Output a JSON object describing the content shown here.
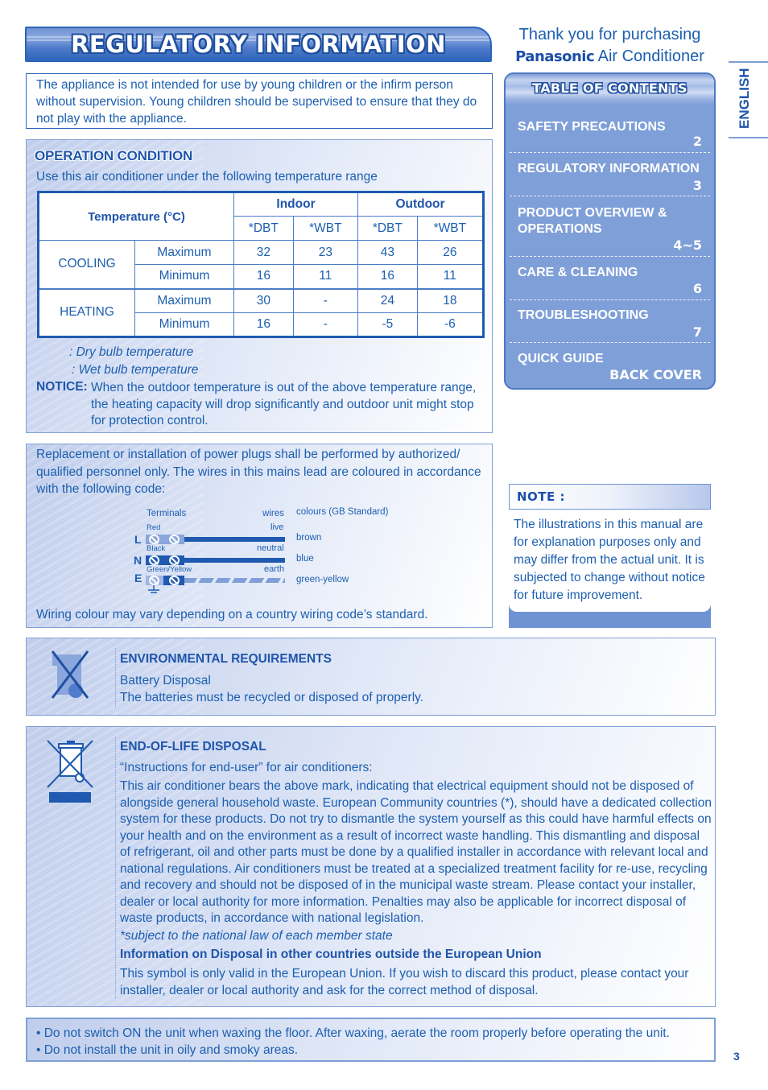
{
  "title": "REGULATORY INFORMATION",
  "warning": "The appliance is not intended for use by young children or the infirm person without supervision. Young children should be supervised to ensure that they do not play with the appliance.",
  "operation_condition": {
    "heading": "OPERATION CONDITION",
    "subtitle": "Use this air conditioner under the following temperature range",
    "table": {
      "corner_header": "Temperature (°C)",
      "group_headers": [
        "Indoor",
        "Outdoor"
      ],
      "sub_headers": [
        "*DBT",
        "*WBT",
        "*DBT",
        "*WBT"
      ],
      "rows": [
        {
          "mode": "COOLING",
          "level": "Maximum",
          "values": [
            "32",
            "23",
            "43",
            "26"
          ]
        },
        {
          "mode": "COOLING",
          "level": "Minimum",
          "values": [
            "16",
            "11",
            "16",
            "11"
          ]
        },
        {
          "mode": "HEATING",
          "level": "Maximum",
          "values": [
            "30",
            "-",
            "24",
            "18"
          ]
        },
        {
          "mode": "HEATING",
          "level": "Minimum",
          "values": [
            "16",
            "-",
            "-5",
            "-6"
          ]
        }
      ]
    },
    "legend": [
      ": Dry bulb temperature",
      ": Wet bulb temperature"
    ],
    "notice_label": "NOTICE:",
    "notice_text": "When the outdoor temperature is out of the above temperature range, the heating capacity will drop significantly and outdoor unit might stop for protection control."
  },
  "wiring": {
    "intro": "Replacement or installation of power plugs shall be performed by authorized/ qualified personnel only. The wires in this mains lead are coloured in accordance with the following code:",
    "terminals_label": "Terminals",
    "wires_label": "wires",
    "colours_label": "colours (GB Standard)",
    "rows": [
      {
        "letter": "L",
        "terminal": "Red",
        "wire": "live",
        "colour": "brown"
      },
      {
        "letter": "N",
        "terminal": "Black",
        "wire": "neutral",
        "colour": "blue"
      },
      {
        "letter": "E",
        "terminal": "Green/Yellow",
        "wire": "earth",
        "colour": "green-yellow"
      }
    ],
    "footer": "Wiring colour may vary depending on a country wiring code’s standard."
  },
  "toc": {
    "thanks_line1": "Thank you for purchasing",
    "brand": "Panasonic",
    "thanks_line2": "Air Conditioner",
    "title": "TABLE OF CONTENTS",
    "items": [
      {
        "label": "SAFETY PRECAUTIONS",
        "page": "2"
      },
      {
        "label": "REGULATORY INFORMATION",
        "page": "3"
      },
      {
        "label": "PRODUCT OVERVIEW & OPERATIONS",
        "page": "4~5"
      },
      {
        "label": "CARE & CLEANING",
        "page": "6"
      },
      {
        "label": "TROUBLESHOOTING",
        "page": "7"
      },
      {
        "label": "QUICK GUIDE",
        "page": "BACK COVER"
      }
    ]
  },
  "language_tab": "ENGLISH",
  "note": {
    "title": "NOTE :",
    "body": "The illustrations in this manual are for explanation purposes only and may differ from the actual unit. It is subjected to change without notice for future improvement."
  },
  "environmental": {
    "heading": "ENVIRONMENTAL REQUIREMENTS",
    "line1": "Battery Disposal",
    "line2": "The batteries must be recycled or disposed of properly."
  },
  "end_of_life": {
    "heading": "END-OF-LIFE DISPOSAL",
    "intro": "“Instructions for end-user” for air conditioners:",
    "body": "This air conditioner bears the above mark, indicating that electrical equipment should not be disposed of alongside general household waste. European Community countries (*), should have a dedicated collection system for these products. Do not try to dismantle the system yourself as this could have harmful effects on your health and on the environment as a result of incorrect waste handling. This dismantling and disposal of refrigerant, oil and other parts must be done by a qualified installer in accordance with relevant local and national regulations. Air conditioners must be treated at a specialized treatment facility for re-use, recycling and recovery and should not be disposed of in the municipal waste stream. Please contact your installer, dealer or local authority for more information. Penalties may also be applicable for incorrect disposal of waste products, in accordance with national legislation.",
    "footnote": "*subject to the national law of each member state",
    "outside_heading": "Information on Disposal in other countries outside the European Union",
    "outside_body": "This symbol is only valid in the European Union. If you wish to discard this product, please contact your installer, dealer or local authority and ask for the correct method of disposal."
  },
  "tips": [
    "• Do not switch ON the unit when waxing the floor. After waxing, aerate the room properly before operating the unit.",
    "• Do not install the unit in oily and smoky areas."
  ],
  "page_number": "3",
  "colors": {
    "primary_blue": "#1c5fb0",
    "toc_bg": "#7f9fd8",
    "banner_border": "#2a64b8"
  }
}
